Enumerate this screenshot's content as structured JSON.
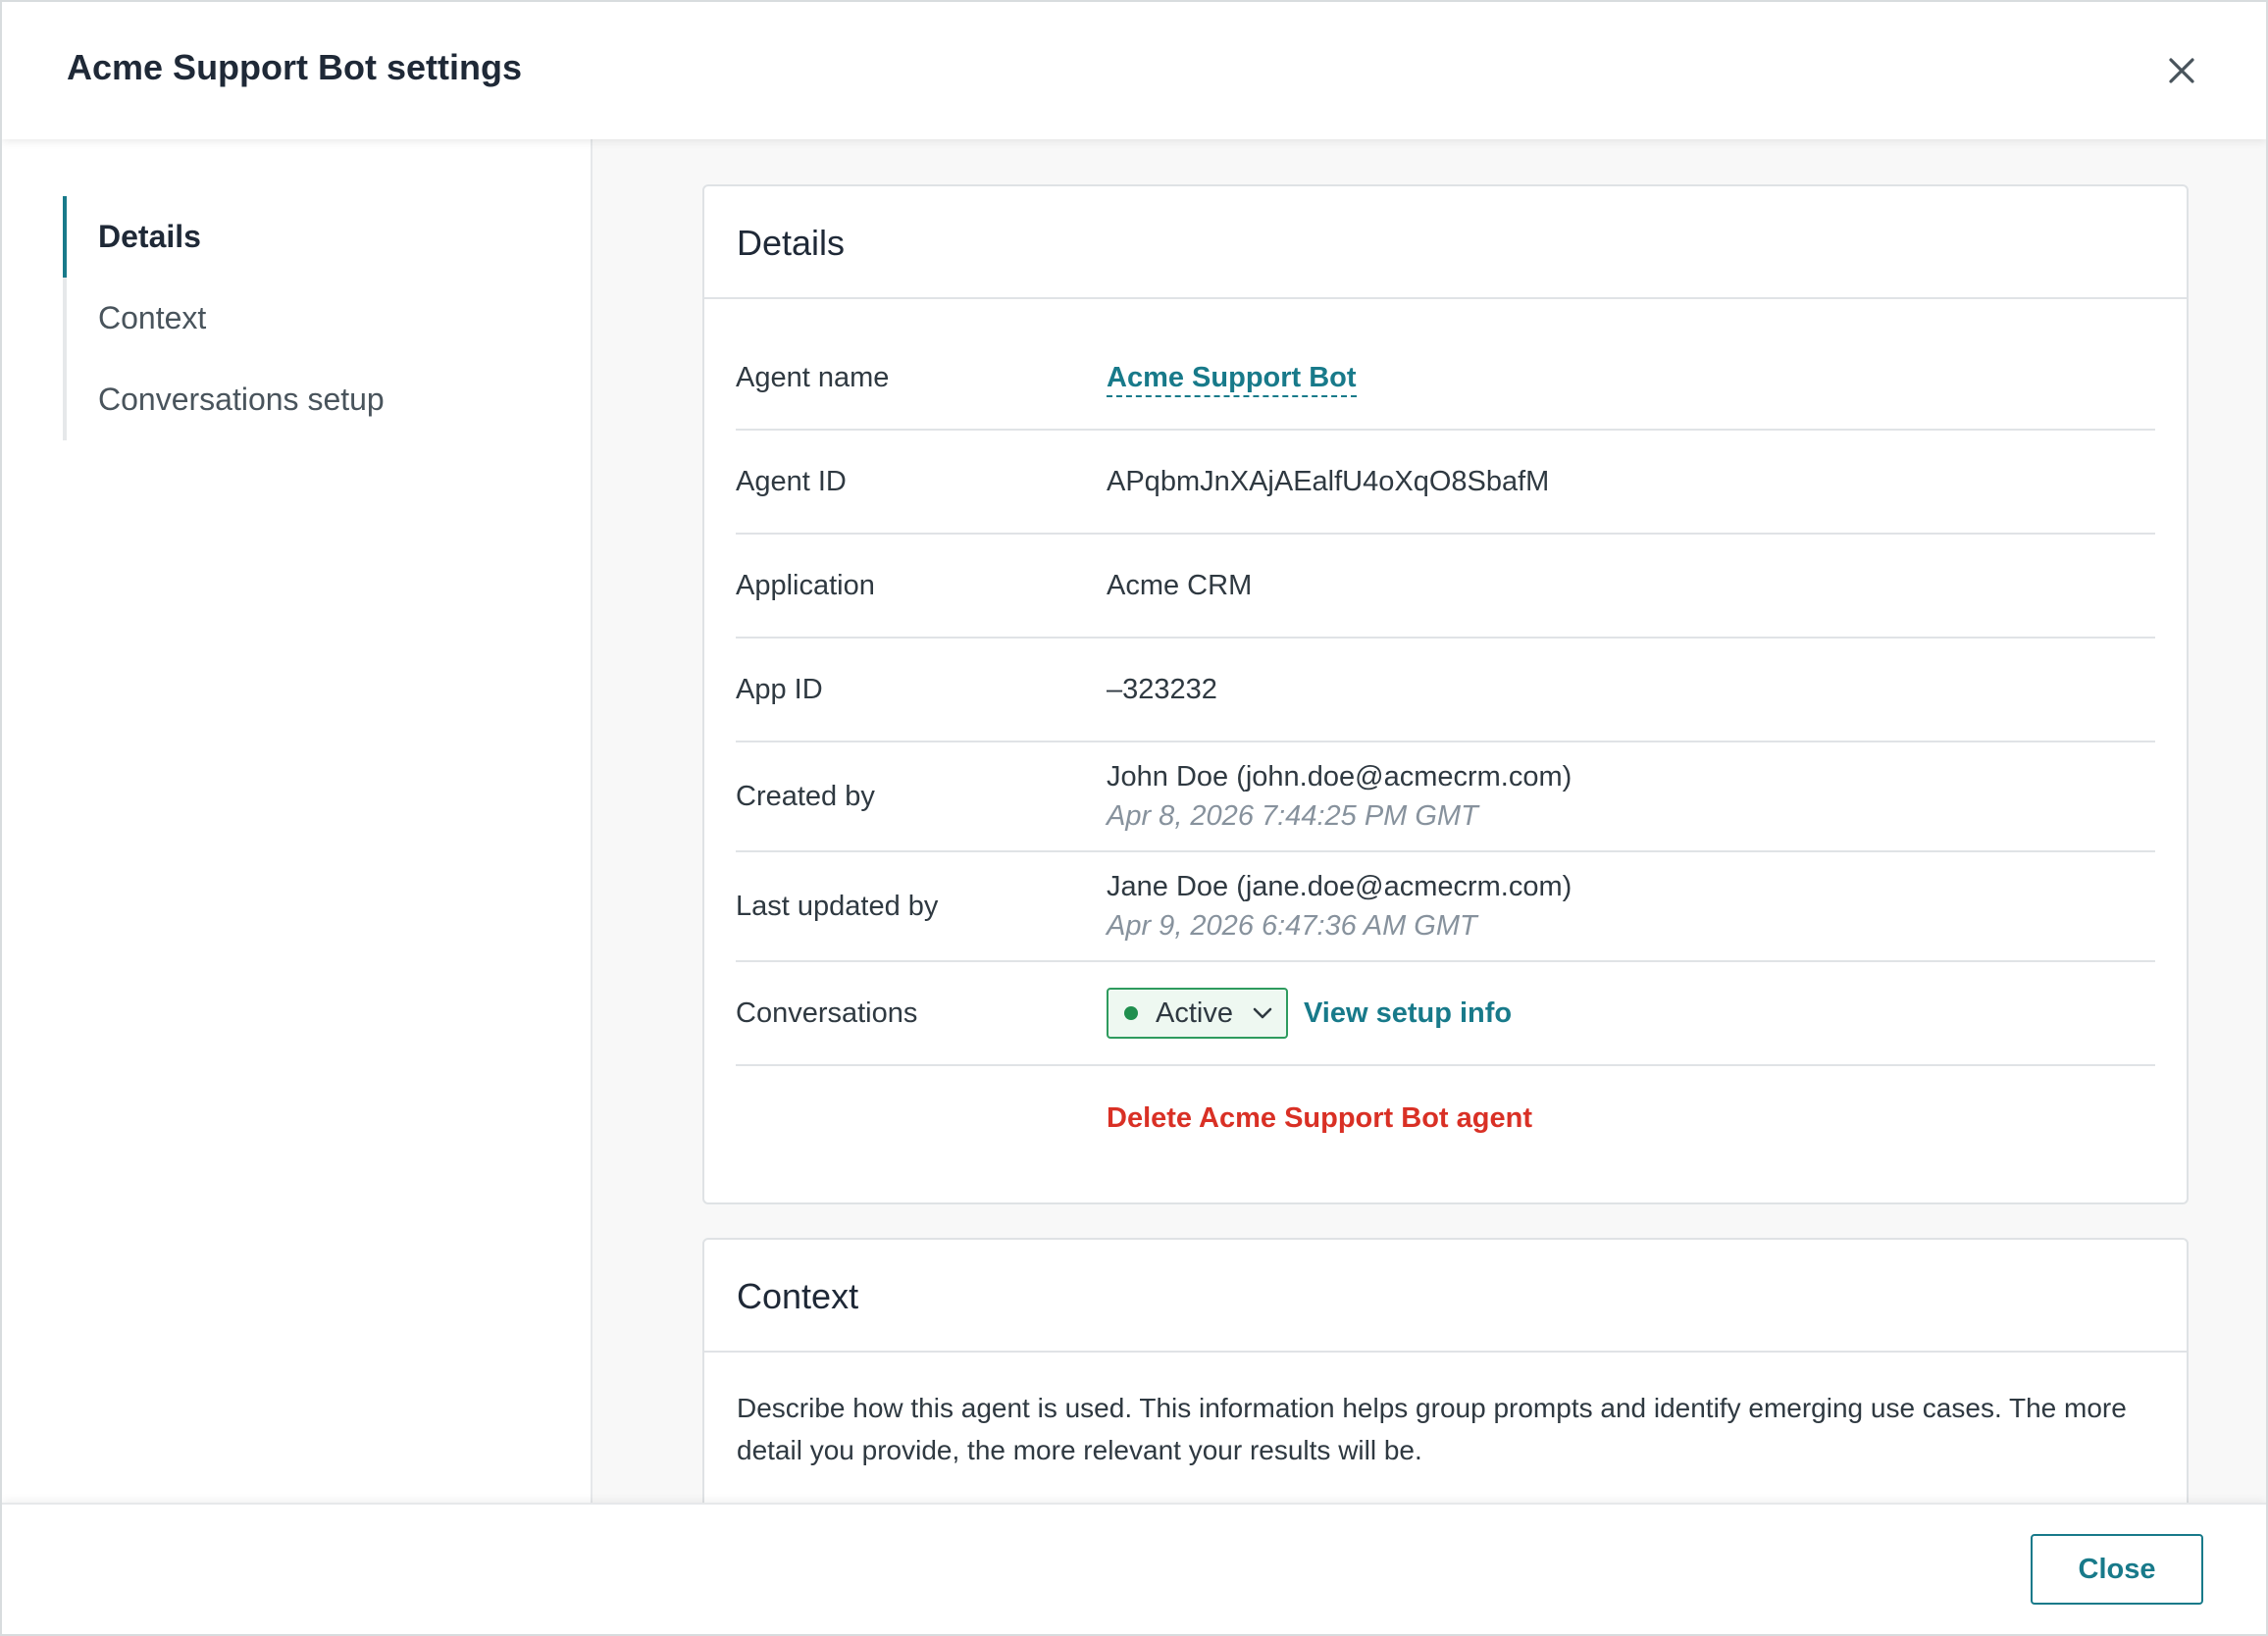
{
  "header": {
    "title": "Acme Support Bot settings"
  },
  "sidebar": {
    "items": [
      {
        "label": "Details",
        "active": true
      },
      {
        "label": "Context",
        "active": false
      },
      {
        "label": "Conversations setup",
        "active": false
      }
    ]
  },
  "details": {
    "heading": "Details",
    "agent_name_label": "Agent name",
    "agent_name_value": "Acme Support Bot",
    "agent_id_label": "Agent ID",
    "agent_id_value": "APqbmJnXAjAEalfU4oXqO8SbafM",
    "application_label": "Application",
    "application_value": "Acme CRM",
    "app_id_label": "App ID",
    "app_id_value": "–323232",
    "created_by_label": "Created by",
    "created_by_user": "John Doe (john.doe@acmecrm.com)",
    "created_by_date": "Apr 8, 2026 7:44:25 PM GMT",
    "updated_by_label": "Last updated by",
    "updated_by_user": "Jane Doe (jane.doe@acmecrm.com)",
    "updated_by_date": "Apr 9, 2026 6:47:36 AM GMT",
    "conversations_label": "Conversations",
    "conversations_status": "Active",
    "view_setup_link": "View setup info",
    "delete_link": "Delete Acme Support Bot agent"
  },
  "context": {
    "heading": "Context",
    "description": "Describe how this agent is used. This information helps group prompts and identify emerging use cases. The more detail you provide, the more relevant your results will be."
  },
  "footer": {
    "close_label": "Close"
  },
  "colors": {
    "accent": "#187a8a",
    "danger": "#d93025",
    "active_green": "#1f8f4e"
  }
}
